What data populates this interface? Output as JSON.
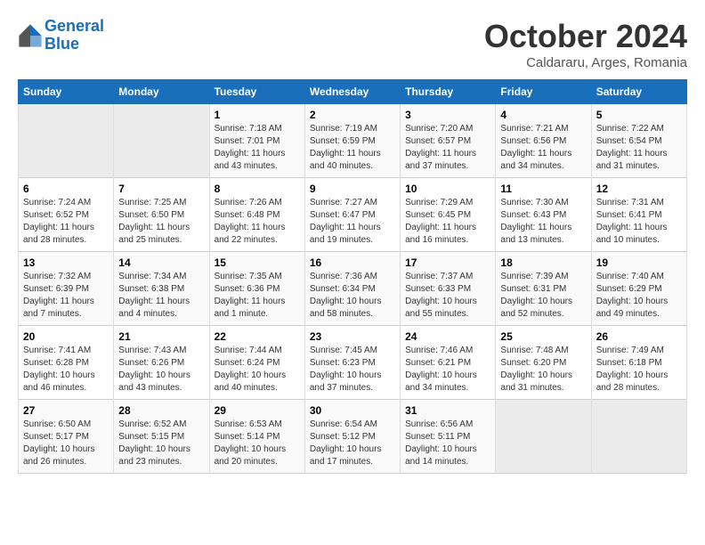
{
  "header": {
    "logo_line1": "General",
    "logo_line2": "Blue",
    "month": "October 2024",
    "location": "Caldararu, Arges, Romania"
  },
  "days_of_week": [
    "Sunday",
    "Monday",
    "Tuesday",
    "Wednesday",
    "Thursday",
    "Friday",
    "Saturday"
  ],
  "weeks": [
    [
      {
        "day": "",
        "info": ""
      },
      {
        "day": "",
        "info": ""
      },
      {
        "day": "1",
        "info": "Sunrise: 7:18 AM\nSunset: 7:01 PM\nDaylight: 11 hours and 43 minutes."
      },
      {
        "day": "2",
        "info": "Sunrise: 7:19 AM\nSunset: 6:59 PM\nDaylight: 11 hours and 40 minutes."
      },
      {
        "day": "3",
        "info": "Sunrise: 7:20 AM\nSunset: 6:57 PM\nDaylight: 11 hours and 37 minutes."
      },
      {
        "day": "4",
        "info": "Sunrise: 7:21 AM\nSunset: 6:56 PM\nDaylight: 11 hours and 34 minutes."
      },
      {
        "day": "5",
        "info": "Sunrise: 7:22 AM\nSunset: 6:54 PM\nDaylight: 11 hours and 31 minutes."
      }
    ],
    [
      {
        "day": "6",
        "info": "Sunrise: 7:24 AM\nSunset: 6:52 PM\nDaylight: 11 hours and 28 minutes."
      },
      {
        "day": "7",
        "info": "Sunrise: 7:25 AM\nSunset: 6:50 PM\nDaylight: 11 hours and 25 minutes."
      },
      {
        "day": "8",
        "info": "Sunrise: 7:26 AM\nSunset: 6:48 PM\nDaylight: 11 hours and 22 minutes."
      },
      {
        "day": "9",
        "info": "Sunrise: 7:27 AM\nSunset: 6:47 PM\nDaylight: 11 hours and 19 minutes."
      },
      {
        "day": "10",
        "info": "Sunrise: 7:29 AM\nSunset: 6:45 PM\nDaylight: 11 hours and 16 minutes."
      },
      {
        "day": "11",
        "info": "Sunrise: 7:30 AM\nSunset: 6:43 PM\nDaylight: 11 hours and 13 minutes."
      },
      {
        "day": "12",
        "info": "Sunrise: 7:31 AM\nSunset: 6:41 PM\nDaylight: 11 hours and 10 minutes."
      }
    ],
    [
      {
        "day": "13",
        "info": "Sunrise: 7:32 AM\nSunset: 6:39 PM\nDaylight: 11 hours and 7 minutes."
      },
      {
        "day": "14",
        "info": "Sunrise: 7:34 AM\nSunset: 6:38 PM\nDaylight: 11 hours and 4 minutes."
      },
      {
        "day": "15",
        "info": "Sunrise: 7:35 AM\nSunset: 6:36 PM\nDaylight: 11 hours and 1 minute."
      },
      {
        "day": "16",
        "info": "Sunrise: 7:36 AM\nSunset: 6:34 PM\nDaylight: 10 hours and 58 minutes."
      },
      {
        "day": "17",
        "info": "Sunrise: 7:37 AM\nSunset: 6:33 PM\nDaylight: 10 hours and 55 minutes."
      },
      {
        "day": "18",
        "info": "Sunrise: 7:39 AM\nSunset: 6:31 PM\nDaylight: 10 hours and 52 minutes."
      },
      {
        "day": "19",
        "info": "Sunrise: 7:40 AM\nSunset: 6:29 PM\nDaylight: 10 hours and 49 minutes."
      }
    ],
    [
      {
        "day": "20",
        "info": "Sunrise: 7:41 AM\nSunset: 6:28 PM\nDaylight: 10 hours and 46 minutes."
      },
      {
        "day": "21",
        "info": "Sunrise: 7:43 AM\nSunset: 6:26 PM\nDaylight: 10 hours and 43 minutes."
      },
      {
        "day": "22",
        "info": "Sunrise: 7:44 AM\nSunset: 6:24 PM\nDaylight: 10 hours and 40 minutes."
      },
      {
        "day": "23",
        "info": "Sunrise: 7:45 AM\nSunset: 6:23 PM\nDaylight: 10 hours and 37 minutes."
      },
      {
        "day": "24",
        "info": "Sunrise: 7:46 AM\nSunset: 6:21 PM\nDaylight: 10 hours and 34 minutes."
      },
      {
        "day": "25",
        "info": "Sunrise: 7:48 AM\nSunset: 6:20 PM\nDaylight: 10 hours and 31 minutes."
      },
      {
        "day": "26",
        "info": "Sunrise: 7:49 AM\nSunset: 6:18 PM\nDaylight: 10 hours and 28 minutes."
      }
    ],
    [
      {
        "day": "27",
        "info": "Sunrise: 6:50 AM\nSunset: 5:17 PM\nDaylight: 10 hours and 26 minutes."
      },
      {
        "day": "28",
        "info": "Sunrise: 6:52 AM\nSunset: 5:15 PM\nDaylight: 10 hours and 23 minutes."
      },
      {
        "day": "29",
        "info": "Sunrise: 6:53 AM\nSunset: 5:14 PM\nDaylight: 10 hours and 20 minutes."
      },
      {
        "day": "30",
        "info": "Sunrise: 6:54 AM\nSunset: 5:12 PM\nDaylight: 10 hours and 17 minutes."
      },
      {
        "day": "31",
        "info": "Sunrise: 6:56 AM\nSunset: 5:11 PM\nDaylight: 10 hours and 14 minutes."
      },
      {
        "day": "",
        "info": ""
      },
      {
        "day": "",
        "info": ""
      }
    ]
  ]
}
